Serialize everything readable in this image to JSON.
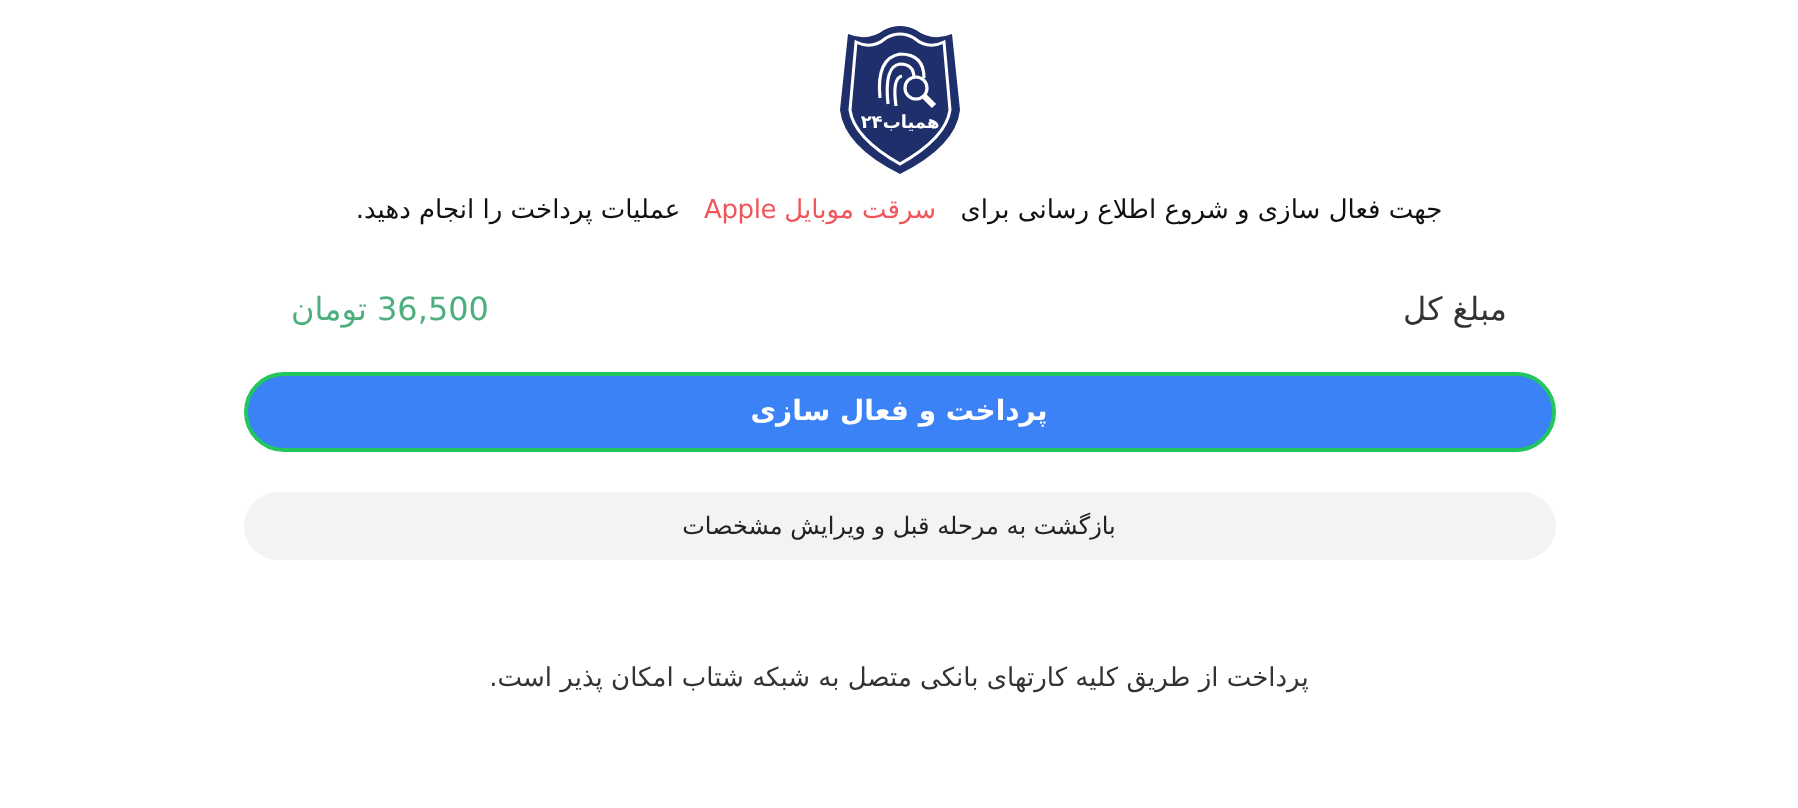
{
  "logo": {
    "text": "همیاب۲۴"
  },
  "intro": {
    "before": "جهت فعال سازی و شروع اطلاع رسانی برای",
    "highlight": "سرقت موبایل Apple",
    "after": "عملیات پرداخت را انجام دهید."
  },
  "total": {
    "label": "مبلغ کل",
    "amount": "36,500 تومان"
  },
  "buttons": [
    {
      "kind": "primary",
      "label": "پرداخت و فعال سازی"
    },
    {
      "kind": "secondary",
      "label": "بازگشت به مرحله قبل و ویرایش مشخصات"
    }
  ],
  "footer_note": "پرداخت از طریق کلیه کارتهای بانکی متصل به شبکه شتاب امکان پذیر است."
}
